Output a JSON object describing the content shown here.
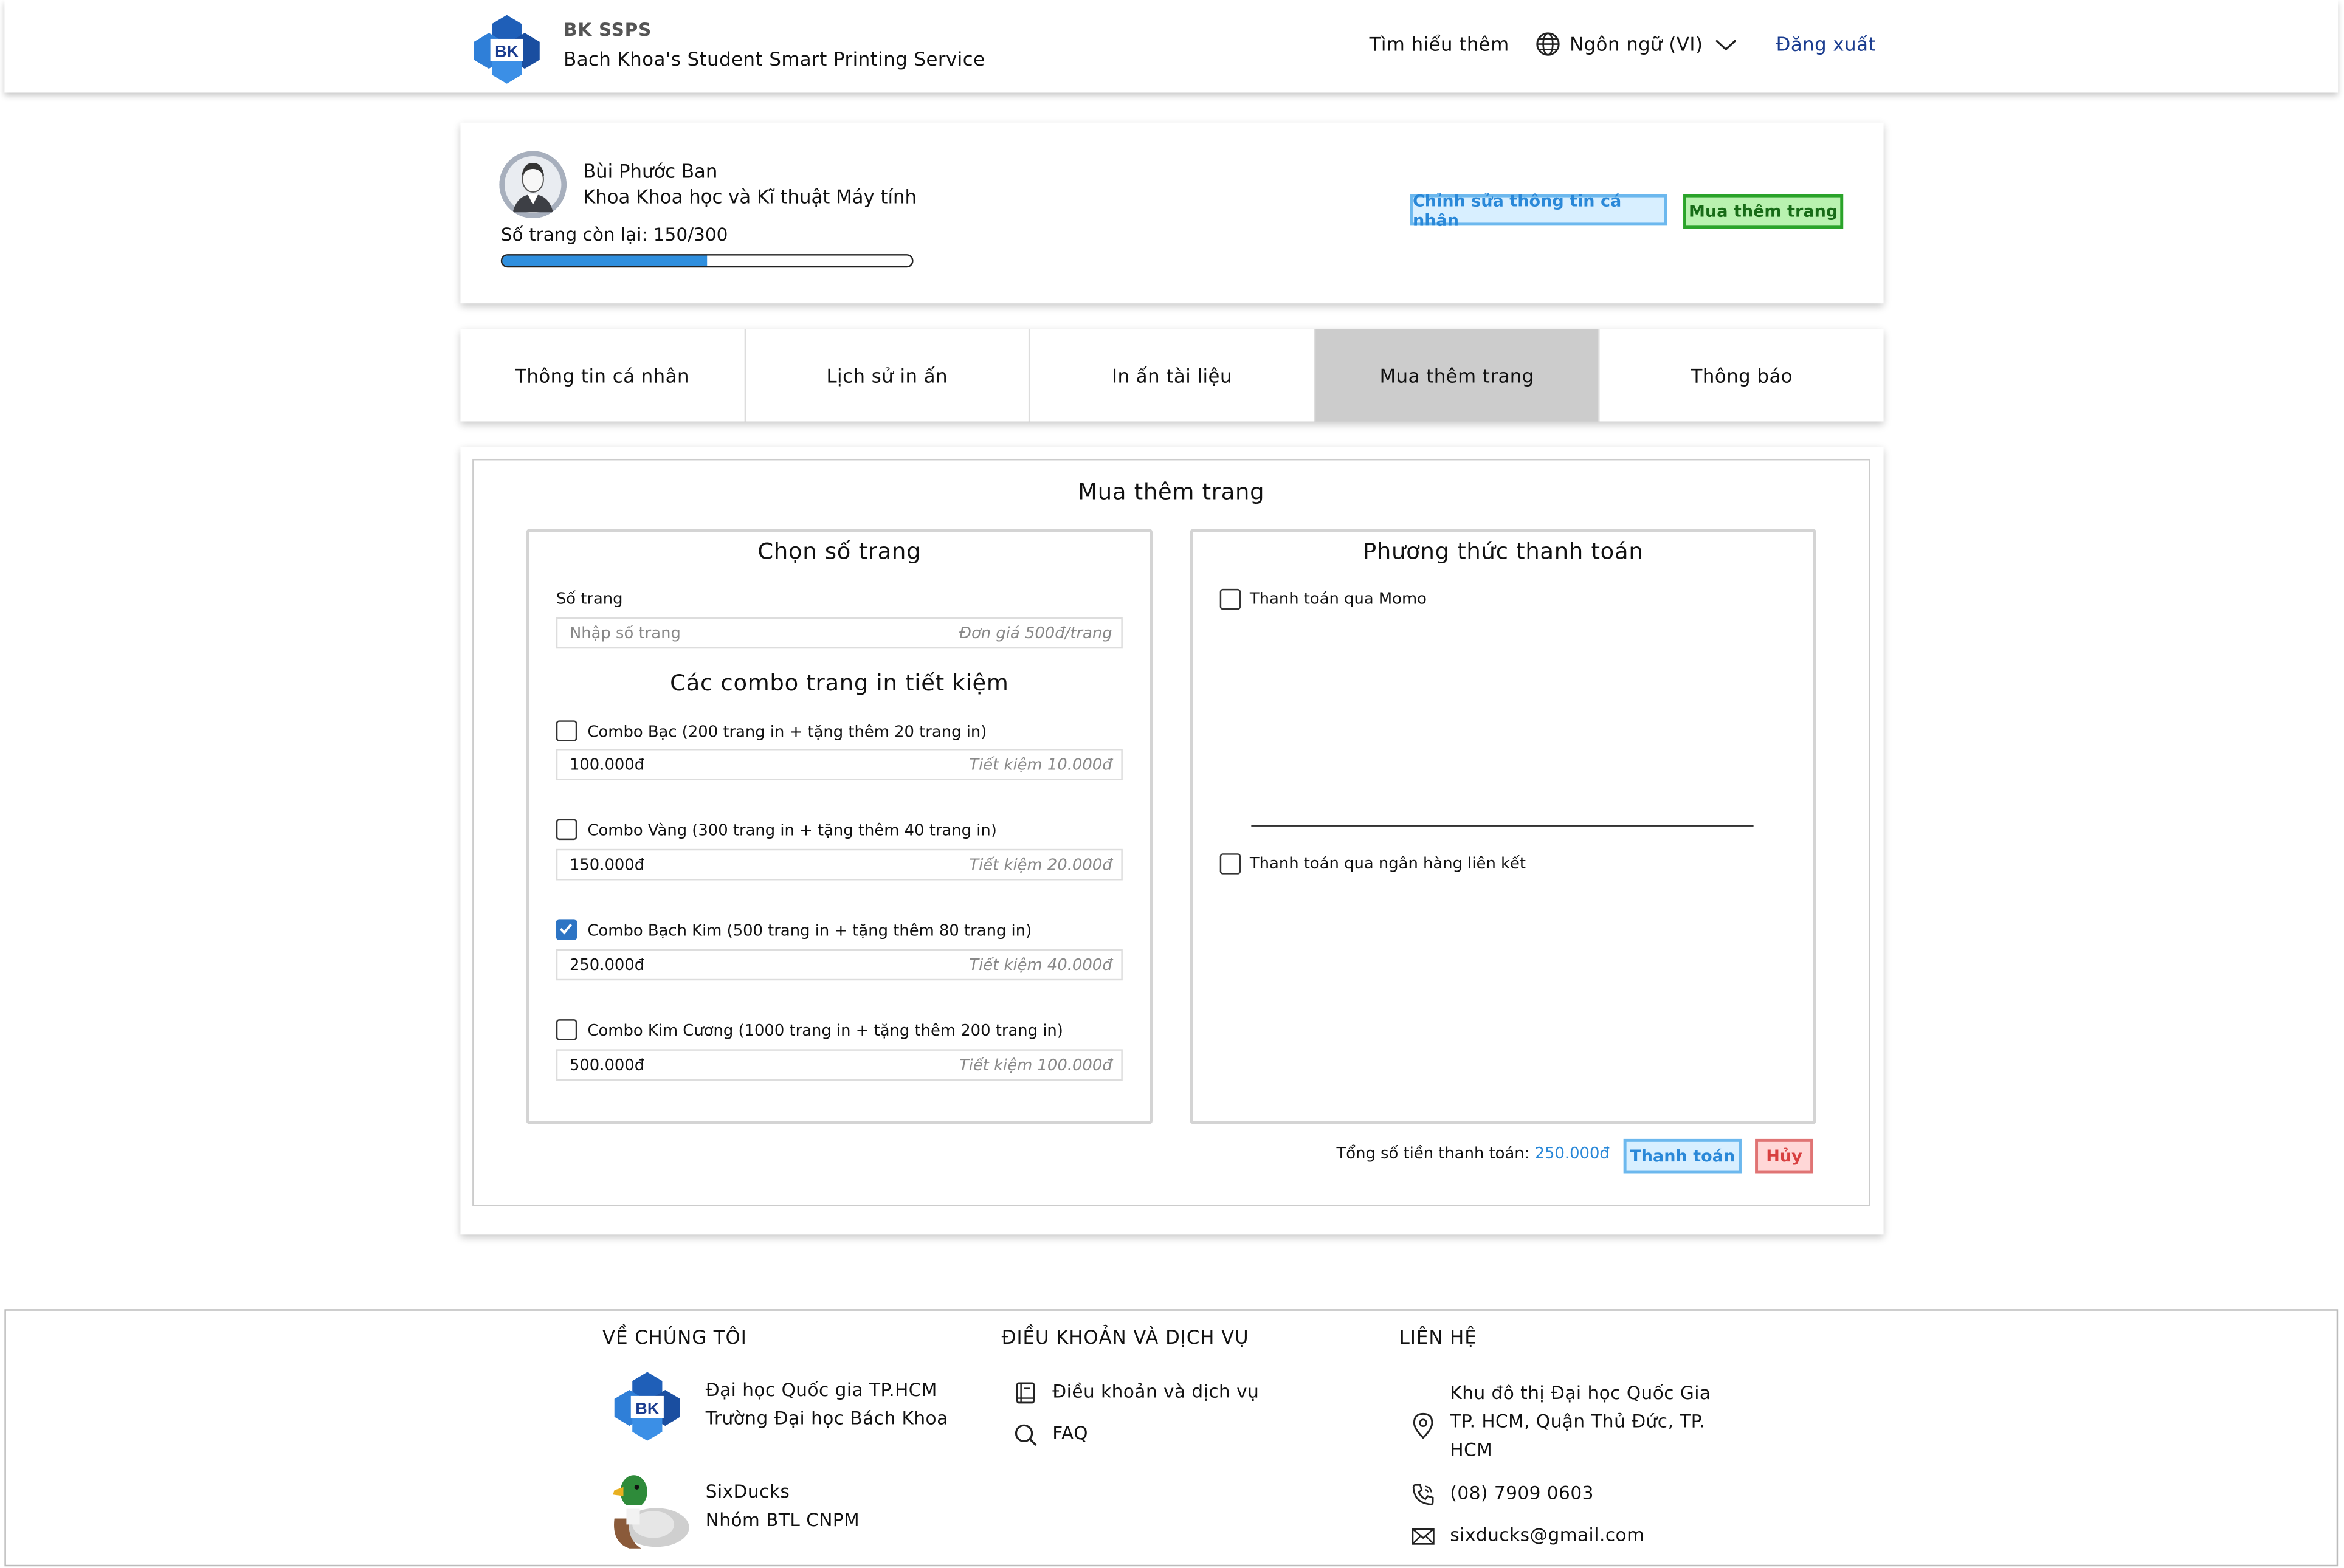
{
  "header": {
    "brand_title": "BK SSPS",
    "brand_subtitle": "Bach Khoa's Student Smart Printing Service",
    "learn_more": "Tìm hiểu thêm",
    "language": "Ngôn ngữ (VI)",
    "logout": "Đăng xuất"
  },
  "profile": {
    "name": "Bùi Phước Ban",
    "department": "Khoa Khoa học và Kĩ thuật Máy tính",
    "pages_remaining": "Số trang còn lại: 150/300",
    "pages_fraction": 0.5,
    "edit_button": "Chỉnh sửa thông tin cá nhân",
    "buy_button": "Mua thêm trang"
  },
  "tabs": [
    {
      "label": "Thông tin cá nhân",
      "active": false
    },
    {
      "label": "Lịch sử in ấn",
      "active": false
    },
    {
      "label": "In ấn tài liệu",
      "active": false
    },
    {
      "label": "Mua thêm trang",
      "active": true
    },
    {
      "label": "Thông báo",
      "active": false
    }
  ],
  "purchase": {
    "title": "Mua thêm trang",
    "select_pages": {
      "title": "Chọn số trang",
      "field_label": "Số trang",
      "placeholder": "Nhập số trang",
      "unit_price": "Đơn giá 500đ/trang",
      "combos_title": "Các combo trang in tiết kiệm",
      "combos": [
        {
          "label": "Combo Bạc (200 trang in + tặng thêm 20 trang in)",
          "price": "100.000đ",
          "saving": "Tiết kiệm 10.000đ",
          "checked": false
        },
        {
          "label": "Combo Vàng (300 trang in + tặng thêm 40 trang in)",
          "price": "150.000đ",
          "saving": "Tiết kiệm 20.000đ",
          "checked": false
        },
        {
          "label": "Combo Bạch Kim (500 trang in + tặng thêm 80 trang in)",
          "price": "250.000đ",
          "saving": "Tiết kiệm 40.000đ",
          "checked": true
        },
        {
          "label": "Combo Kim Cương (1000 trang in + tặng thêm 200 trang in)",
          "price": "500.000đ",
          "saving": "Tiết kiệm 100.000đ",
          "checked": false
        }
      ]
    },
    "payment": {
      "title": "Phương thức thanh toán",
      "momo": "Thanh toán qua Momo",
      "bank": "Thanh toán qua ngân hàng liên kết"
    },
    "total_label": "Tổng số tiền thanh toán:",
    "total_value": "250.000đ",
    "pay_button": "Thanh toán",
    "cancel_button": "Hủy"
  },
  "footer": {
    "about": {
      "title": "VỀ CHÚNG TÔI",
      "uni_line1": "Đại học Quốc gia TP.HCM",
      "uni_line2": "Trường Đại học Bách Khoa",
      "team_line1": "SixDucks",
      "team_line2": "Nhóm BTL CNPM"
    },
    "terms": {
      "title": "ĐIỀU KHOẢN VÀ DỊCH VỤ",
      "terms_link": "Điều khoản và dịch vụ",
      "faq_link": "FAQ"
    },
    "contact": {
      "title": "LIÊN HỆ",
      "address_line1": "Khu đô thị Đại học Quốc Gia",
      "address_line2": "TP. HCM, Quận Thủ Đức, TP.",
      "address_line3": "HCM",
      "phone": "(08) 7909 0603",
      "email": "sixducks@gmail.com"
    }
  },
  "colors": {
    "accent_blue": "#2a88d8",
    "progress_fill": "#2f8fde",
    "brand_navy": "#1a3c8f",
    "buy_green": "#2aa32a",
    "cancel_red": "#e07474",
    "active_tab": "#cccccc"
  },
  "icons": [
    "bk-logo-icon",
    "globe-icon",
    "chevron-down-icon",
    "avatar-icon",
    "checkbox-icon",
    "book-icon",
    "search-icon",
    "location-pin-icon",
    "phone-icon",
    "mail-icon",
    "duck-logo-icon"
  ]
}
